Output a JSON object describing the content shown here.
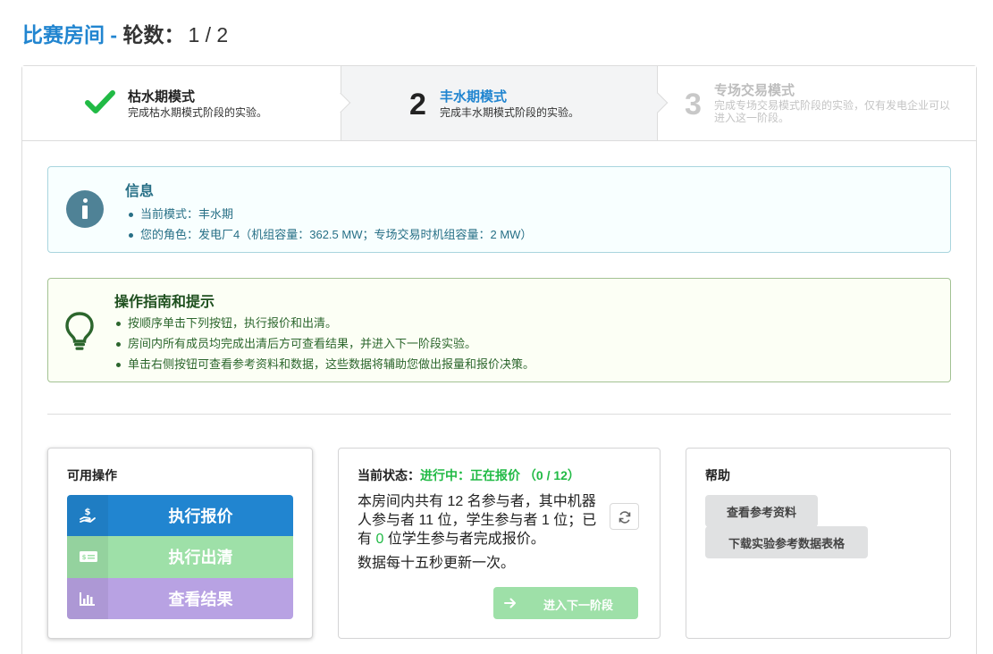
{
  "header": {
    "title_prefix": "比赛房间",
    "title_dash": " - ",
    "round_label": "轮数：",
    "round_value": "1 / 2"
  },
  "steps": [
    {
      "number": "",
      "title": "枯水期模式",
      "description": "完成枯水期模式阶段的实验。",
      "status": "completed"
    },
    {
      "number": "2",
      "title": "丰水期模式",
      "description": "完成丰水期模式阶段的实验。",
      "status": "active"
    },
    {
      "number": "3",
      "title": "专场交易模式",
      "description": "完成专场交易模式阶段的实验，仅有发电企业可以进入这一阶段。",
      "status": "disabled"
    }
  ],
  "info": {
    "header": "信息",
    "items": [
      "当前模式：丰水期",
      "您的角色：发电厂4（机组容量：362.5 MW；专场交易时机组容量：2 MW）"
    ]
  },
  "tips": {
    "header": "操作指南和提示",
    "items": [
      "按顺序单击下列按钮，执行报价和出清。",
      "房间内所有成员均完成出清后方可查看结果，并进入下一阶段实验。",
      "单击右侧按钮可查看参考资料和数据，这些数据将辅助您做出报量和报价决策。"
    ]
  },
  "operations": {
    "title": "可用操作",
    "buttons": [
      {
        "label": "执行报价",
        "icon": "hand-dollar-icon"
      },
      {
        "label": "执行出清",
        "icon": "money-bill-icon"
      },
      {
        "label": "查看结果",
        "icon": "bar-chart-icon"
      }
    ]
  },
  "status": {
    "label": "当前状态：",
    "value": "进行中：正在报价 （0 / 12）",
    "text_before": "本房间内共有 12 名参与者，其中机器人参与者 11 位，学生参与者 1 位；已有 ",
    "done_count": "0",
    "text_after": " 位学生参与者完成报价。",
    "refresh_note": "数据每十五秒更新一次。",
    "next_button": "进入下一阶段"
  },
  "help": {
    "title": "帮助",
    "buttons": [
      "查看参考资料",
      "下载实验参考数据表格"
    ]
  },
  "colors": {
    "primary": "#2185d0",
    "success": "#21ba45",
    "green_light": "#9ee0a8",
    "violet_light": "#b8a2e3"
  }
}
